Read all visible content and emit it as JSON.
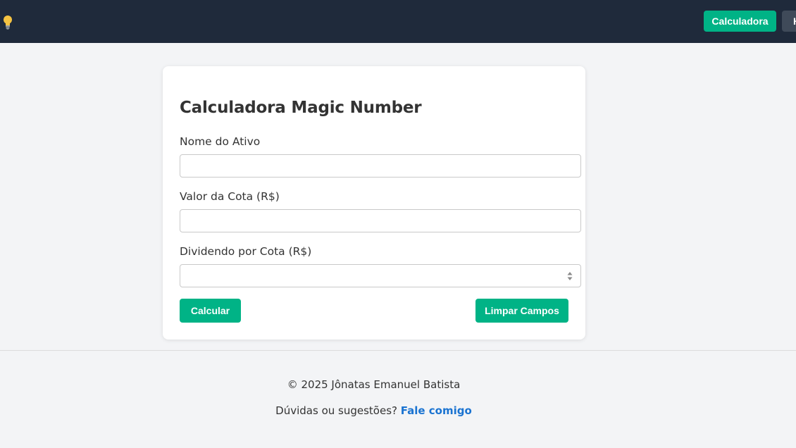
{
  "navbar": {
    "logo_icon": "lightbulb-icon",
    "buttons": [
      {
        "label": "Calculadora",
        "color": "#00b386"
      },
      {
        "label": "H",
        "color": "#3f4a59"
      }
    ]
  },
  "form": {
    "title": "Calculadora Magic Number",
    "fields": [
      {
        "label": "Nome do Ativo",
        "value": "",
        "type": "text"
      },
      {
        "label": "Valor da Cota (R$)",
        "value": "",
        "type": "text"
      },
      {
        "label": "Dividendo por Cota (R$)",
        "value": "",
        "type": "number"
      }
    ],
    "calc_label": "Calcular",
    "clear_label": "Limpar Campos",
    "accent": "#00b386"
  },
  "footer": {
    "copyright": "© 2025 Jônatas Emanuel Batista",
    "question": "Dúvidas ou sugestões?",
    "link_text": "Fale comigo",
    "link_color": "#1a73d1"
  },
  "colors": {
    "navbar_bg": "#1f2a3b",
    "page_bg": "#f3f4f6"
  }
}
